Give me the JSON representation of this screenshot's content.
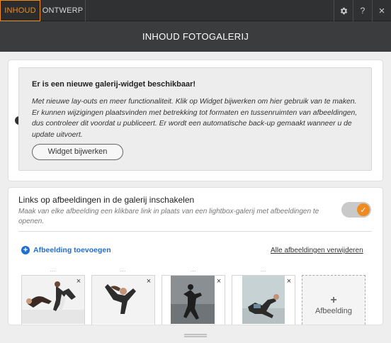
{
  "tabs": {
    "content": "INHOUD",
    "design": "ONTWERP"
  },
  "toolbar": {
    "help_label": "?",
    "close_label": "×"
  },
  "header": {
    "title": "INHOUD FOTOGALERIJ"
  },
  "notice": {
    "title": "Er is een nieuwe galerij-widget beschikbaar!",
    "body": "Met nieuwe lay-outs en meer functionaliteit. Klik op Widget bijwerken om hier gebruik van te maken. Er kunnen wijzigingen plaatsvinden met betrekking tot formaten en tussenruimten van afbeeldingen, dus controleer dit voordat u publiceert. Er wordt een automatische back-up gemaakt wanneer u de update uitvoert.",
    "button": "Widget bijwerken",
    "icon": "exclamation-icon"
  },
  "links": {
    "title": "Links op afbeeldingen in de galerij inschakelen",
    "description": "Maak van elke afbeelding een klikbare link in plaats van een lightbox-galerij met afbeeldingen te openen.",
    "toggle_on": true,
    "toggle_check": "✓"
  },
  "gallery": {
    "add_label": "Afbeelding toevoegen",
    "remove_all_label": "Alle afbeeldingen verwijderen",
    "add_tile_plus": "+",
    "add_tile_label": "Afbeelding",
    "drag_handle": "⋯",
    "remove_symbol": "×",
    "images": [
      "dancers-image",
      "dancer-jump-image",
      "dancer-silhouette-image",
      "dancer-kneeling-image"
    ]
  },
  "colors": {
    "accent": "#ef8b1f",
    "link": "#1e6fd0",
    "header_bg": "#3a3c3e",
    "tabbar_bg": "#2f3133"
  }
}
